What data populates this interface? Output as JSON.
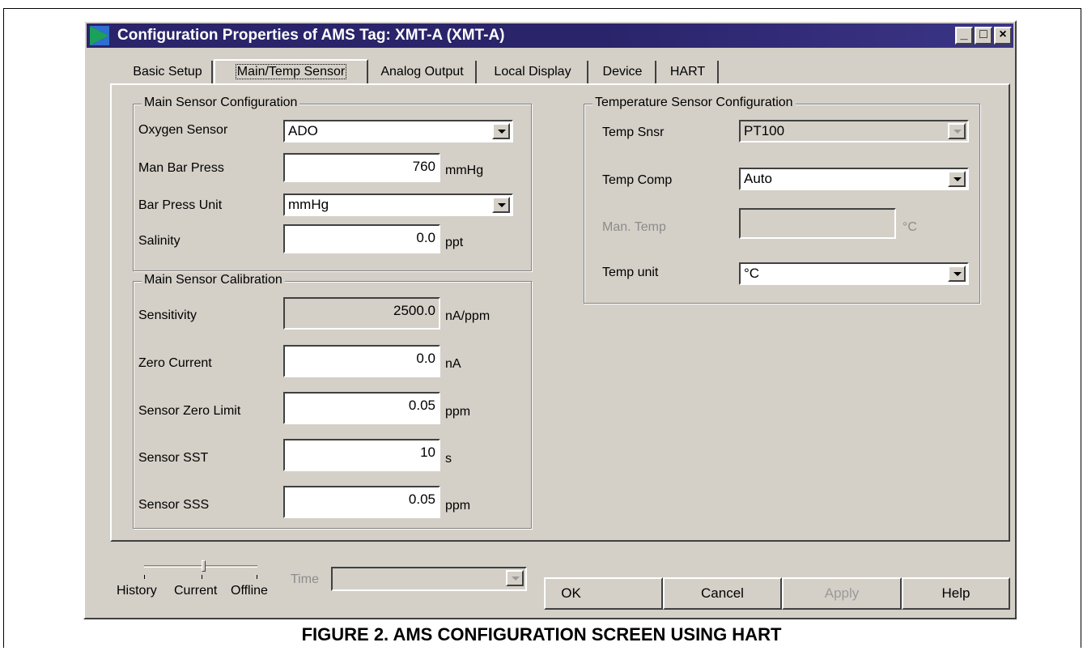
{
  "window": {
    "title": "Configuration Properties of AMS Tag:  XMT-A (XMT-A)",
    "minimize_glyph": "_",
    "maximize_glyph": "□",
    "close_glyph": "×"
  },
  "tabs": [
    {
      "label": "Basic Setup"
    },
    {
      "label": "Main/Temp Sensor",
      "active": true
    },
    {
      "label": "Analog Output"
    },
    {
      "label": "Local Display"
    },
    {
      "label": "Device"
    },
    {
      "label": "HART"
    }
  ],
  "main_config": {
    "title": "Main Sensor Configuration",
    "oxygen_sensor": {
      "label": "Oxygen Sensor",
      "value": "ADO"
    },
    "man_bar_press": {
      "label": "Man Bar Press",
      "value": "760",
      "unit": "mmHg"
    },
    "bar_press_unit": {
      "label": "Bar Press Unit",
      "value": "mmHg"
    },
    "salinity": {
      "label": "Salinity",
      "value": "0.0",
      "unit": "ppt"
    }
  },
  "main_cal": {
    "title": "Main Sensor Calibration",
    "sensitivity": {
      "label": "Sensitivity",
      "value": "2500.0",
      "unit": "nA/ppm"
    },
    "zero_current": {
      "label": "Zero Current",
      "value": "0.0",
      "unit": "nA"
    },
    "zero_limit": {
      "label": "Sensor Zero Limit",
      "value": "0.05",
      "unit": "ppm"
    },
    "sst": {
      "label": "Sensor SST",
      "value": "10",
      "unit": "s"
    },
    "sss": {
      "label": "Sensor SSS",
      "value": "0.05",
      "unit": "ppm"
    }
  },
  "temp_config": {
    "title": "Temperature Sensor Configuration",
    "temp_snsr": {
      "label": "Temp Snsr",
      "value": "PT100"
    },
    "temp_comp": {
      "label": "Temp Comp",
      "value": "Auto"
    },
    "man_temp": {
      "label": "Man. Temp",
      "value": "",
      "unit": "°C"
    },
    "temp_unit": {
      "label": "Temp unit",
      "value": "°C"
    }
  },
  "bottom": {
    "slider_labels": {
      "history": "History",
      "current": "Current",
      "offline": "Offline"
    },
    "time_label": "Time",
    "time_value": "",
    "ok": "OK",
    "cancel": "Cancel",
    "apply": "Apply",
    "help": "Help"
  },
  "caption": "FIGURE 2. AMS CONFIGURATION SCREEN USING HART",
  "colors": {
    "title_bar": "#2a246b",
    "dialog_face": "#d4d0c8",
    "app_icon_green": "#1f9e5a",
    "app_icon_blue": "#2b6fd1"
  }
}
